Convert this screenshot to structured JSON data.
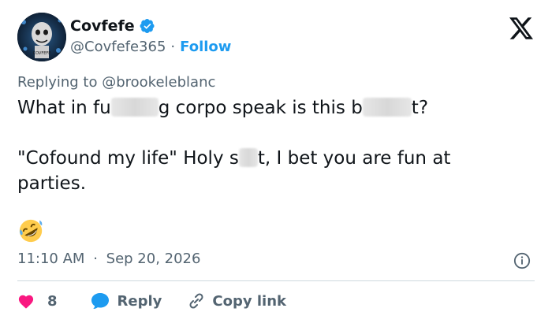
{
  "author": {
    "display_name": "Covfefe",
    "handle": "@Covfefe365",
    "separator": "·",
    "follow_label": "Follow",
    "avatar_text": "COVFEFE"
  },
  "reply_context": {
    "prefix": "Replying to",
    "mention": "@brookeleblanc"
  },
  "tweet": {
    "line1_a": "What in fu",
    "line1_b": "g corpo speak is this b",
    "line1_c": "t?",
    "line2_a": "\"Cofound my life\" Holy s",
    "line2_b": "t, I bet you are fun at",
    "line3": "parties.",
    "emoji": "rolling-on-floor-laughing"
  },
  "meta": {
    "time": "11:10 AM",
    "separator": "·",
    "date": "Sep 20, 2026"
  },
  "actions": {
    "like_count": "8",
    "reply_label": "Reply",
    "copy_link_label": "Copy link"
  },
  "colors": {
    "accent": "#1d9bf0",
    "like": "#f91880",
    "text": "#0f1419",
    "muted": "#536471",
    "divider": "#cfd9de"
  }
}
